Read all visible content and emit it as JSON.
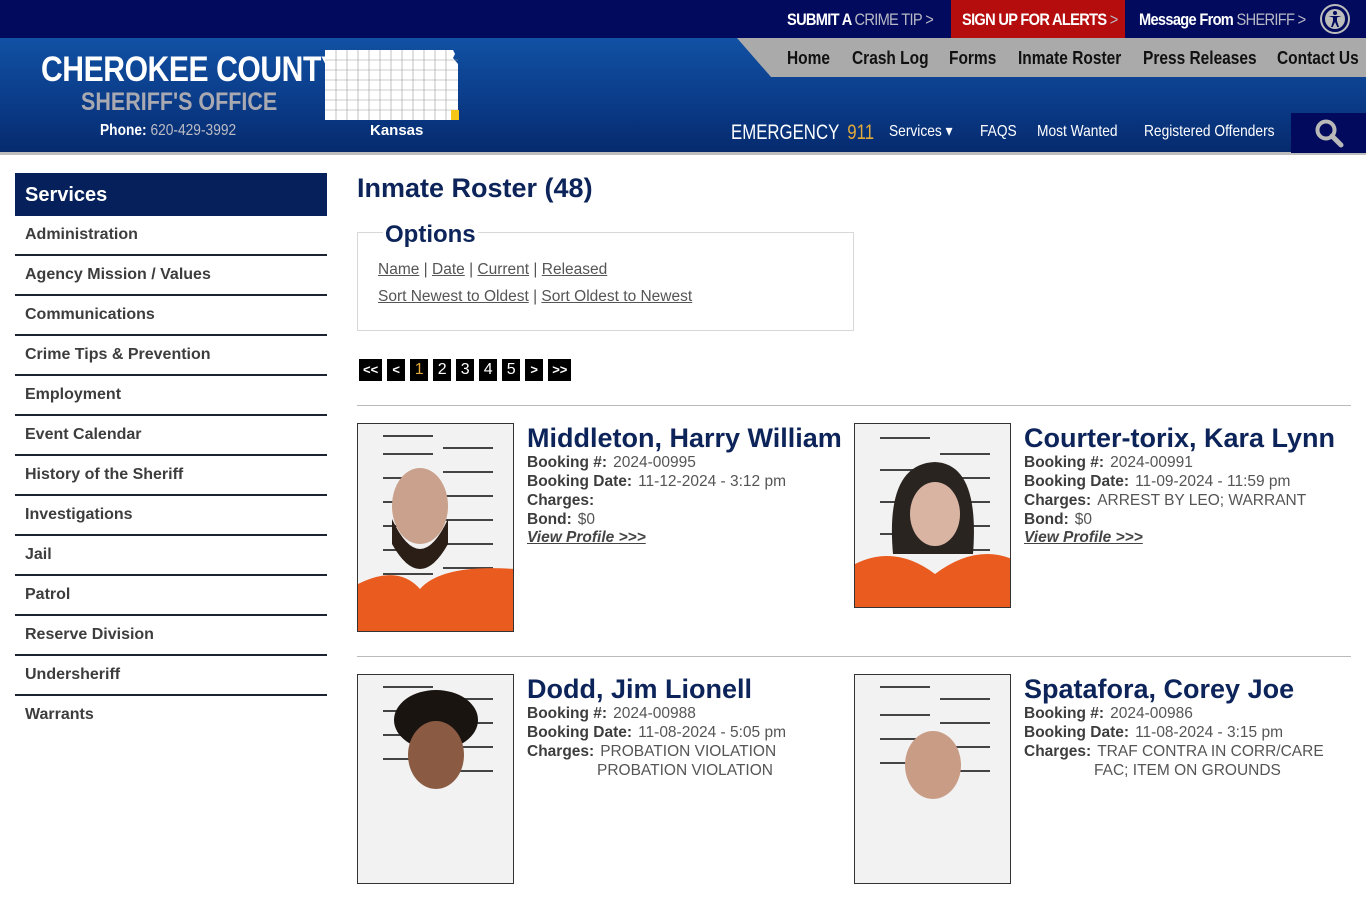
{
  "topbar": {
    "crime_tip": {
      "a": "SUBMIT A",
      "b": "CRIME TIP",
      "arrow": ">"
    },
    "alerts": {
      "a": "SIGN UP FOR ALERTS",
      "arrow": ">"
    },
    "message": {
      "a": "Message From",
      "b": "SHERIFF",
      "arrow": ">"
    },
    "accessibility_icon": "accessibility-icon"
  },
  "header": {
    "title": "CHEROKEE COUNTY",
    "subtitle": "SHERIFF'S OFFICE",
    "phone_label": "Phone:",
    "phone": "620-429-3992",
    "map_label": "Kansas",
    "highlight_color": "#f5c518"
  },
  "main_nav": [
    "Home",
    "Crash Log",
    "Forms",
    "Inmate Roster",
    "Press Releases",
    "Contact Us"
  ],
  "sub_nav": {
    "emergency_label": "EMERGENCY",
    "emergency_number": "911",
    "items": [
      "Services",
      "FAQS",
      "Most Wanted",
      "Registered Offenders"
    ],
    "services_caret": "▾"
  },
  "sidebar": {
    "heading": "Services",
    "items": [
      "Administration",
      "Agency Mission / Values",
      "Communications",
      "Crime Tips & Prevention",
      "Employment",
      "Event Calendar",
      "History of the Sheriff",
      "Investigations",
      "Jail",
      "Patrol",
      "Reserve Division",
      "Undersheriff",
      "Warrants"
    ]
  },
  "page": {
    "title": "Inmate Roster (48)",
    "options": {
      "legend": "Options",
      "filters": [
        "Name",
        "Date",
        "Current",
        "Released"
      ],
      "sorts": [
        "Sort Newest to Oldest",
        "Sort Oldest to Newest"
      ],
      "separator": "|"
    },
    "pagination": {
      "first": "<<",
      "prev": "<",
      "pages": [
        "1",
        "2",
        "3",
        "4",
        "5"
      ],
      "current": "1",
      "next": ">",
      "last": ">>"
    },
    "labels": {
      "booking_no": "Booking #:",
      "booking_date": "Booking Date:",
      "charges": "Charges:",
      "bond": "Bond:",
      "view_profile": "View Profile >>>"
    },
    "inmates": [
      {
        "name": "Middleton, Harry William",
        "booking_no": "2024-00995",
        "booking_date": "11-12-2024 - 3:12 pm",
        "charges": "",
        "bond": "$0"
      },
      {
        "name": "Courter-torix, Kara Lynn",
        "booking_no": "2024-00991",
        "booking_date": "11-09-2024 - 11:59 pm",
        "charges": "ARREST BY LEO; WARRANT",
        "bond": "$0"
      },
      {
        "name": "Dodd, Jim Lionell",
        "booking_no": "2024-00988",
        "booking_date": "11-08-2024 - 5:05 pm",
        "charges": "PROBATION VIOLATION",
        "charges2": "PROBATION VIOLATION"
      },
      {
        "name": "Spatafora, Corey Joe",
        "booking_no": "2024-00986",
        "booking_date": "11-08-2024 - 3:15 pm",
        "charges": "TRAF CONTRA IN CORR/CARE",
        "charges2": "FAC; ITEM ON GROUNDS"
      }
    ]
  },
  "colors": {
    "navy": "#020a5e",
    "brand_blue": "#0c2459",
    "alert_red": "#b50d0d",
    "gold": "#e0a93a"
  }
}
